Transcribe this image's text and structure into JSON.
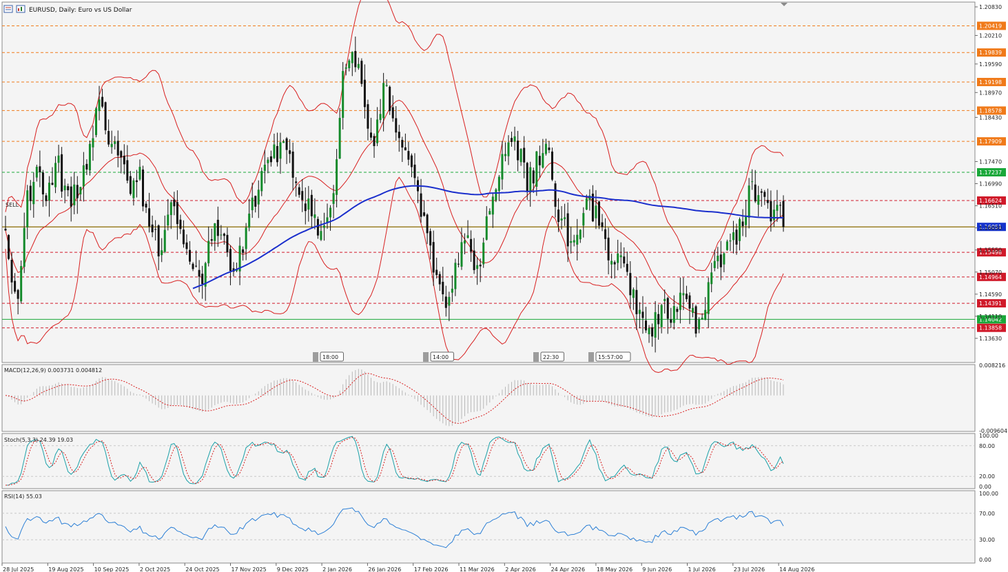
{
  "window": {
    "title": "EURUSD, Daily:  Euro vs US Dollar",
    "toolbar_icons": [
      "list-icon",
      "chart-window-icon"
    ]
  },
  "chart_data": [
    {
      "type": "candlestick",
      "symbol": "EURUSD",
      "timeframe": "Daily",
      "ylim": [
        1.1312,
        1.2092
      ],
      "price_ticks": [
        "1.20830",
        "1.20210",
        "1.19590",
        "1.18970",
        "1.18430",
        "1.17470",
        "1.16990",
        "1.16510",
        "1.16030",
        "1.15550",
        "1.15070",
        "1.14590",
        "1.14110",
        "1.13630"
      ],
      "x_tick_labels": [
        "28 Jul 2025",
        "19 Aug 2025",
        "10 Sep 2025",
        "2 Oct 2025",
        "24 Oct 2025",
        "17 Nov 2025",
        "9 Dec 2025",
        "2 Jan 2026",
        "26 Jan 2026",
        "17 Feb 2026",
        "11 Mar 2026",
        "2 Apr 2026",
        "24 Apr 2026",
        "18 May 2026",
        "9 Jun 2026",
        "1 Jul 2026",
        "23 Jul 2026",
        "14 Aug 2026"
      ],
      "close_path": [
        1.16,
        1.143,
        1.165,
        1.172,
        1.168,
        1.175,
        1.166,
        1.168,
        1.176,
        1.187,
        1.181,
        1.177,
        1.17,
        1.172,
        1.161,
        1.156,
        1.165,
        1.16,
        1.154,
        1.149,
        1.158,
        1.16,
        1.152,
        1.155,
        1.165,
        1.17,
        1.176,
        1.178,
        1.173,
        1.168,
        1.163,
        1.157,
        1.166,
        1.195,
        1.2,
        1.187,
        1.18,
        1.19,
        1.185,
        1.178,
        1.172,
        1.16,
        1.148,
        1.144,
        1.153,
        1.158,
        1.15,
        1.16,
        1.172,
        1.18,
        1.178,
        1.17,
        1.175,
        1.177,
        1.163,
        1.158,
        1.162,
        1.165,
        1.161,
        1.152,
        1.156,
        1.148,
        1.14,
        1.138,
        1.143,
        1.141,
        1.145,
        1.142,
        1.138,
        1.15,
        1.155,
        1.157,
        1.162,
        1.169,
        1.167,
        1.163,
        1.162
      ],
      "current_price": "1.16051",
      "horizontal_levels": [
        {
          "value": "1.20419",
          "color": "#f07a1a",
          "style": "dashed"
        },
        {
          "value": "1.19839",
          "color": "#f07a1a",
          "style": "dashed"
        },
        {
          "value": "1.19198",
          "color": "#f07a1a",
          "style": "dashed"
        },
        {
          "value": "1.18578",
          "color": "#f07a1a",
          "style": "dashed"
        },
        {
          "value": "1.17909",
          "color": "#f07a1a",
          "style": "dashed"
        },
        {
          "value": "1.17237",
          "color": "#1aa83a",
          "style": "dashed"
        },
        {
          "value": "1.16624",
          "color": "#d01a2a",
          "style": "dashed"
        },
        {
          "value": "1.16051",
          "color": "#1533cc",
          "style": "current"
        },
        {
          "value": "1.15498",
          "color": "#d01a2a",
          "style": "dashed"
        },
        {
          "value": "1.14964",
          "color": "#d01a2a",
          "style": "dashed"
        },
        {
          "value": "1.14391",
          "color": "#d01a2a",
          "style": "dashed"
        },
        {
          "value": "1.14042",
          "color": "#1aa83a",
          "style": "solid"
        },
        {
          "value": "1.13858",
          "color": "#d01a2a",
          "style": "dashed"
        }
      ],
      "sell_label": "SELL",
      "event_markers": [
        "18:00",
        "14:00",
        "22:30",
        "15:57:00"
      ],
      "colors": {
        "bull_candle": "#138a2a",
        "bear_candle": "#111111",
        "bollinger": "#d81e1e",
        "ma": "#1a2ecc",
        "current_line": "#8a6a00"
      }
    },
    {
      "type": "histogram",
      "title": "MACD(12,26,9) 0.003731 0.004812",
      "ylim": [
        -0.009604,
        0.008216
      ],
      "tick_labels": [
        "0.008216",
        "-0.009604"
      ]
    },
    {
      "type": "line",
      "title": "Stoch(5,3,3) 24.39 19.03",
      "ylim": [
        0,
        100
      ],
      "tick_labels": [
        "100.00",
        "80.00",
        "20.00",
        "0.00"
      ]
    },
    {
      "type": "line",
      "title": "RSI(14) 55.03",
      "ylim": [
        0,
        100
      ],
      "tick_labels": [
        "100.00",
        "70.00",
        "30.00",
        "0.00"
      ]
    }
  ]
}
